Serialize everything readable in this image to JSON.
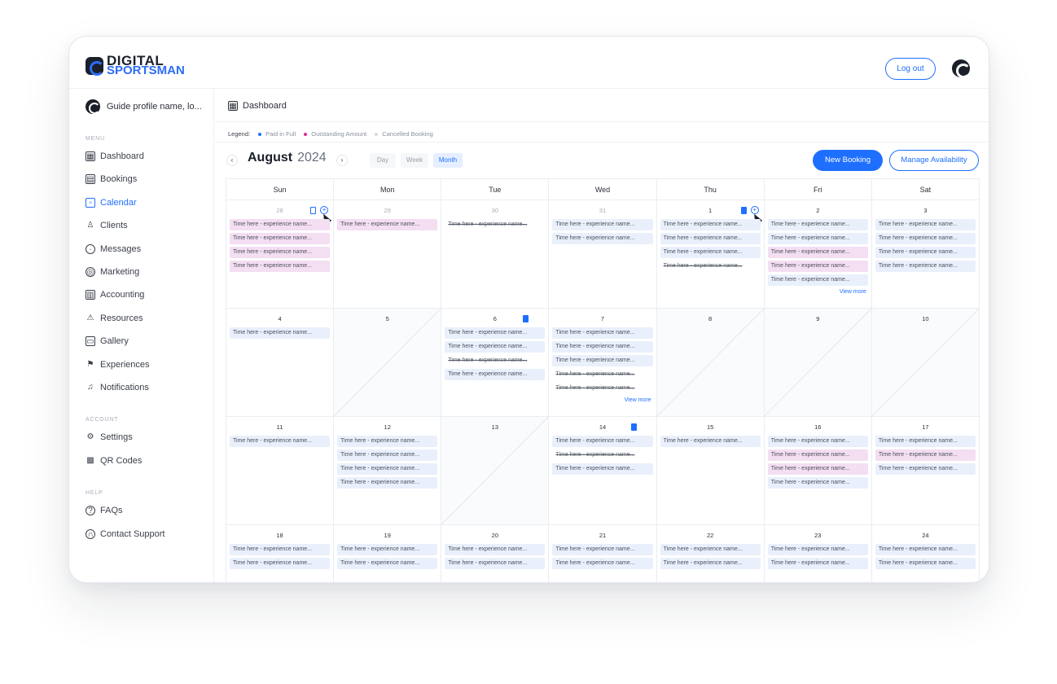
{
  "brand": {
    "line1": "DIGITAL",
    "line2": "SPORTSMAN"
  },
  "topbar": {
    "logout_label": "Log out"
  },
  "sidebar": {
    "profile_name": "Guide profile name, lo...",
    "menu_label": "MENU",
    "menu": [
      {
        "label": "Dashboard",
        "icon": "dashboard-icon"
      },
      {
        "label": "Bookings",
        "icon": "bookings-icon"
      },
      {
        "label": "Calendar",
        "icon": "calendar-icon"
      },
      {
        "label": "Clients",
        "icon": "clients-icon"
      },
      {
        "label": "Messages",
        "icon": "messages-icon"
      },
      {
        "label": "Marketing",
        "icon": "marketing-icon"
      },
      {
        "label": "Accounting",
        "icon": "accounting-icon"
      },
      {
        "label": "Resources",
        "icon": "resources-icon"
      },
      {
        "label": "Gallery",
        "icon": "gallery-icon"
      },
      {
        "label": "Experiences",
        "icon": "experiences-icon"
      },
      {
        "label": "Notifications",
        "icon": "bell-icon"
      }
    ],
    "account_label": "ACCOUNT",
    "account": [
      {
        "label": "Settings",
        "icon": "gear-icon"
      },
      {
        "label": "QR Codes",
        "icon": "qr-code-icon"
      }
    ],
    "help_label": "HELP",
    "help": [
      {
        "label": "FAQs",
        "icon": "question-icon"
      },
      {
        "label": "Contact Support",
        "icon": "headset-icon"
      }
    ]
  },
  "main": {
    "breadcrumb": "Dashboard",
    "legend": {
      "label": "Legend:",
      "items": [
        {
          "label": "Paid in Full",
          "color": "#1f6fff"
        },
        {
          "label": "Outstanding Amount",
          "color": "#e0278f"
        },
        {
          "label": "Cancelled Booking",
          "color": "#d7dae0"
        }
      ]
    },
    "month": "August",
    "year": "2024",
    "view_tabs": [
      "Day",
      "Week",
      "Month"
    ],
    "active_view": "Month",
    "new_booking_label": "New Booking",
    "manage_availability_label": "Manage Availability"
  },
  "calendar": {
    "event_text": "Time here - experience name...",
    "view_more": "View more",
    "days_of_week": [
      "Sun",
      "Mon",
      "Tue",
      "Wed",
      "Thu",
      "Fri",
      "Sat"
    ],
    "weeks": [
      [
        {
          "num": "28",
          "muted": true,
          "icons": [
            "doc",
            "plus"
          ],
          "events": [
            "out",
            "out",
            "out",
            "out"
          ]
        },
        {
          "num": "29",
          "muted": true,
          "events": [
            "out"
          ]
        },
        {
          "num": "30",
          "muted": true,
          "events": [
            "can"
          ]
        },
        {
          "num": "31",
          "muted": true,
          "events": [
            "paid",
            "paid"
          ]
        },
        {
          "num": "1",
          "icons": [
            "docf",
            "plus"
          ],
          "events": [
            "paid",
            "paid",
            "paid",
            "can"
          ]
        },
        {
          "num": "2",
          "events": [
            "paid",
            "paid",
            "out",
            "out",
            "paid"
          ],
          "more": true
        },
        {
          "num": "3",
          "events": [
            "paid",
            "paid",
            "paid",
            "paid"
          ]
        }
      ],
      [
        {
          "num": "4",
          "events": [
            "paid"
          ]
        },
        {
          "num": "5",
          "blocked": true,
          "events": []
        },
        {
          "num": "6",
          "icons": [
            "docf"
          ],
          "events": [
            "paid",
            "paid",
            "can",
            "paid"
          ]
        },
        {
          "num": "7",
          "events": [
            "paid",
            "paid",
            "paid",
            "can",
            "can"
          ],
          "more": true
        },
        {
          "num": "8",
          "blocked": true,
          "events": []
        },
        {
          "num": "9",
          "blocked": true,
          "events": []
        },
        {
          "num": "10",
          "blocked": true,
          "events": []
        }
      ],
      [
        {
          "num": "11",
          "events": [
            "paid"
          ]
        },
        {
          "num": "12",
          "events": [
            "paid",
            "paid",
            "paid",
            "paid"
          ]
        },
        {
          "num": "13",
          "blocked": true,
          "events": []
        },
        {
          "num": "14",
          "icons": [
            "docf"
          ],
          "events": [
            "paid",
            "can",
            "paid"
          ]
        },
        {
          "num": "15",
          "events": [
            "paid"
          ]
        },
        {
          "num": "16",
          "events": [
            "paid",
            "out",
            "out",
            "paid"
          ]
        },
        {
          "num": "17",
          "events": [
            "paid",
            "out",
            "paid"
          ]
        }
      ],
      [
        {
          "num": "18",
          "events": [
            "paid",
            "paid"
          ]
        },
        {
          "num": "19",
          "events": [
            "paid",
            "paid"
          ]
        },
        {
          "num": "20",
          "events": [
            "paid",
            "paid"
          ]
        },
        {
          "num": "21",
          "events": [
            "paid",
            "paid"
          ]
        },
        {
          "num": "22",
          "events": [
            "paid",
            "paid"
          ]
        },
        {
          "num": "23",
          "events": [
            "paid",
            "paid"
          ]
        },
        {
          "num": "24",
          "events": [
            "paid",
            "paid"
          ]
        }
      ]
    ]
  }
}
